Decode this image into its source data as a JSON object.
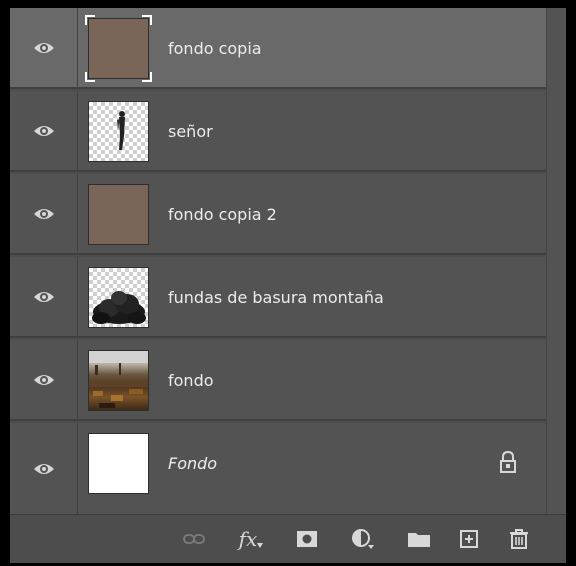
{
  "layers_panel": {
    "layers": [
      {
        "name": "fondo copia",
        "thumbnail": "brown-fill",
        "selected": true,
        "visible": true,
        "italic": false,
        "locked": false
      },
      {
        "name": "señor",
        "thumbnail": "transparent-figure",
        "selected": false,
        "visible": true,
        "italic": false,
        "locked": false
      },
      {
        "name": "fondo copia 2",
        "thumbnail": "brown-fill",
        "selected": false,
        "visible": true,
        "italic": false,
        "locked": false
      },
      {
        "name": "fundas de basura montaña",
        "thumbnail": "transparent-garbage-bags",
        "selected": false,
        "visible": true,
        "italic": false,
        "locked": false
      },
      {
        "name": "fondo",
        "thumbnail": "landfill-photo",
        "selected": false,
        "visible": true,
        "italic": false,
        "locked": false
      },
      {
        "name": "Fondo",
        "thumbnail": "white-fill",
        "selected": false,
        "visible": true,
        "italic": true,
        "locked": true
      }
    ],
    "footer_tools": [
      "link-layers-icon",
      "fx-icon",
      "layer-mask-icon",
      "adjustment-layer-icon",
      "group-folder-icon",
      "new-layer-icon",
      "trash-icon"
    ],
    "fx_label": "fx"
  },
  "colors": {
    "panel_bg": "#4d4d4d",
    "row_bg": "#535353",
    "row_selected_bg": "#696969",
    "text": "#ececec",
    "swatch_brown": "#7a6658"
  }
}
